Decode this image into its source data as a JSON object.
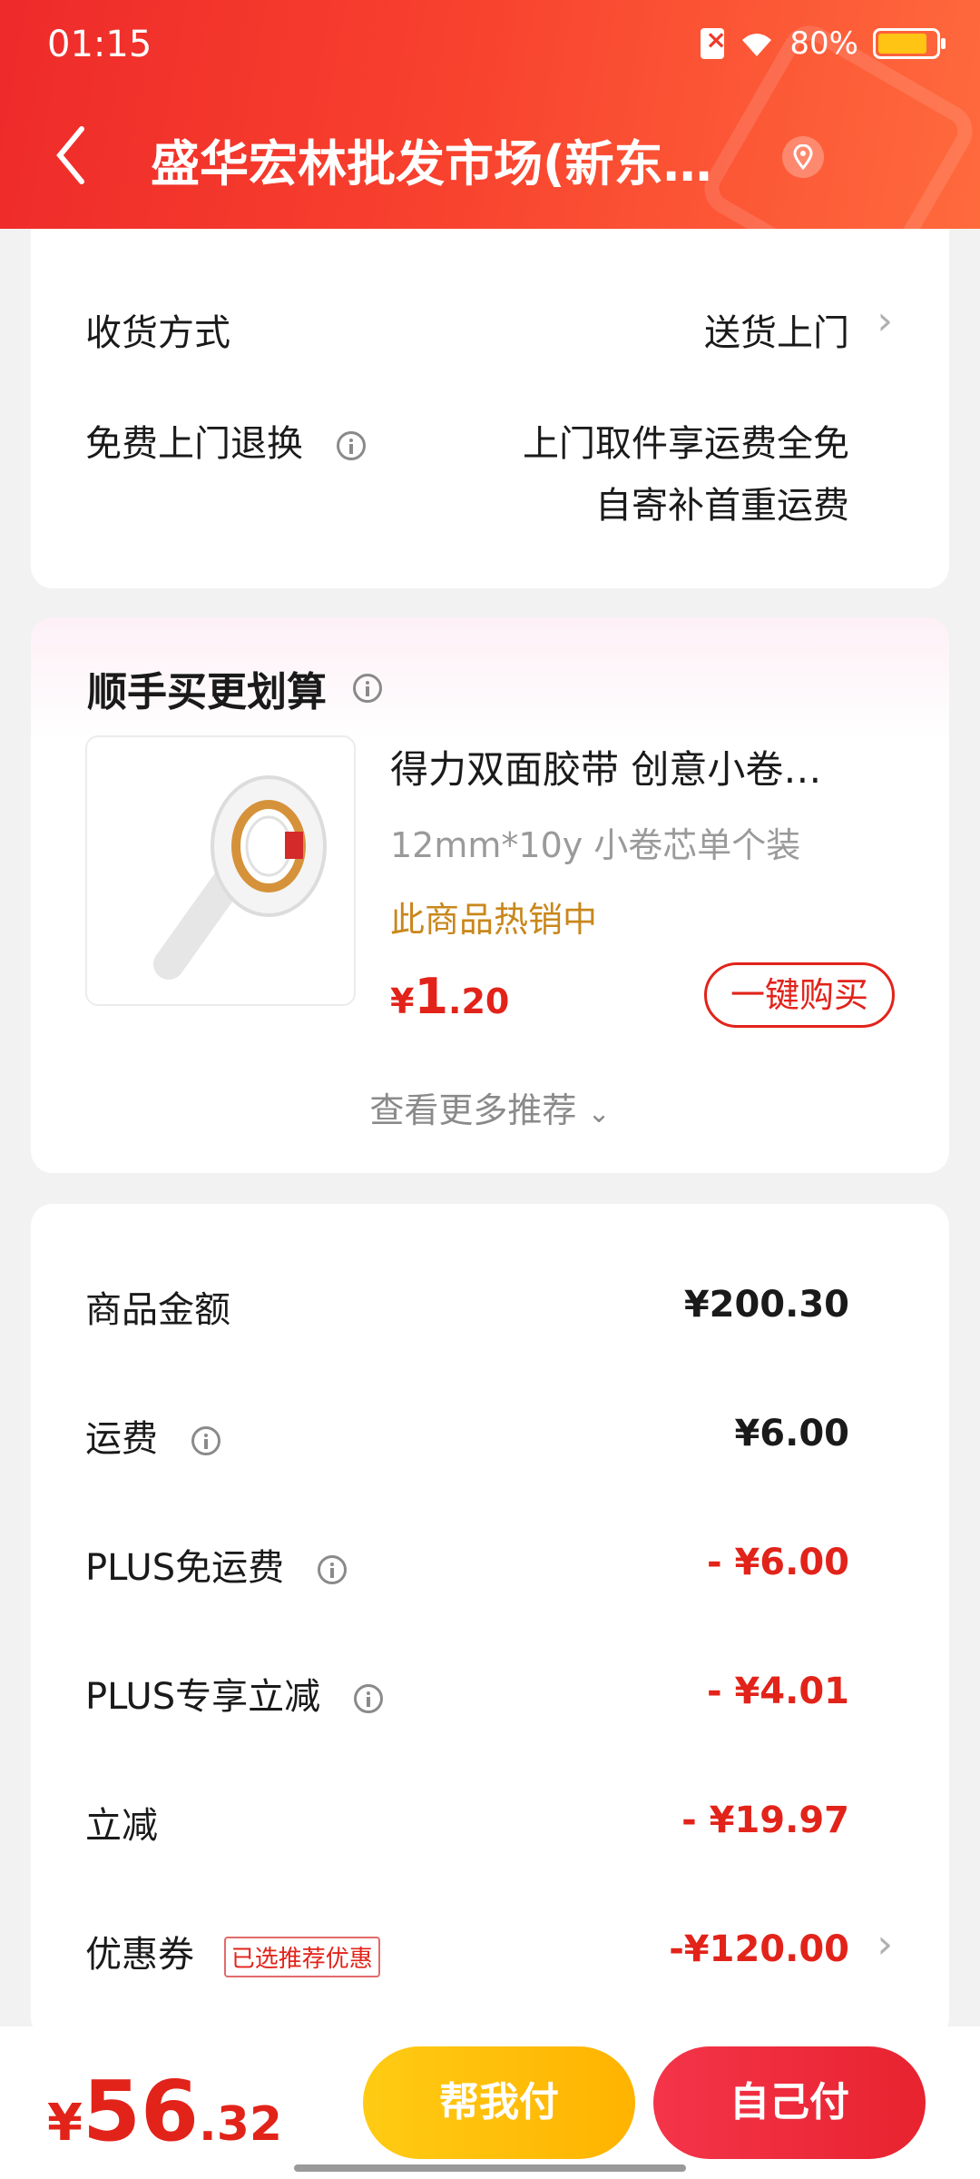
{
  "status_bar": {
    "time": "01:15",
    "battery": "80%",
    "battery_level": 0.8
  },
  "header": {
    "title": "盛华宏林批发市场(新东…"
  },
  "delivery": {
    "method_label": "收货方式",
    "method_value": "送货上门",
    "return_label": "免费上门退换",
    "return_line1": "上门取件享运费全免",
    "return_line2": "自寄补首重运费"
  },
  "recommend": {
    "title": "顺手买更划算",
    "product": {
      "name": "得力双面胶带 创意小卷…",
      "spec": "12mm*10y 小卷芯单个装",
      "hot": "此商品热销中",
      "price_symbol": "¥",
      "price_int": "1",
      "price_dec": ".20",
      "buy_label": "一键购买"
    },
    "more_label": "查看更多推荐"
  },
  "summary": {
    "rows": [
      {
        "label": "商品金额",
        "value": "¥200.30"
      },
      {
        "label": "运费",
        "value": "¥6.00"
      },
      {
        "label": "PLUS免运费",
        "value": "- ¥6.00"
      },
      {
        "label": "PLUS专享立减",
        "value": "- ¥4.01"
      },
      {
        "label": "立减",
        "value": "- ¥19.97"
      },
      {
        "label": "优惠券",
        "value": "-¥120.00",
        "tag": "已选推荐优惠"
      }
    ]
  },
  "bottom": {
    "total_symbol": "¥",
    "total_int": "56",
    "total_dec": ".32",
    "help_label": "帮我付",
    "pay_label": "自己付"
  },
  "colors": {
    "accent_red": "#e2231a",
    "header_red": "#f03a2b",
    "help_yellow": "#ffc414",
    "hot_orange": "#c9871b"
  }
}
